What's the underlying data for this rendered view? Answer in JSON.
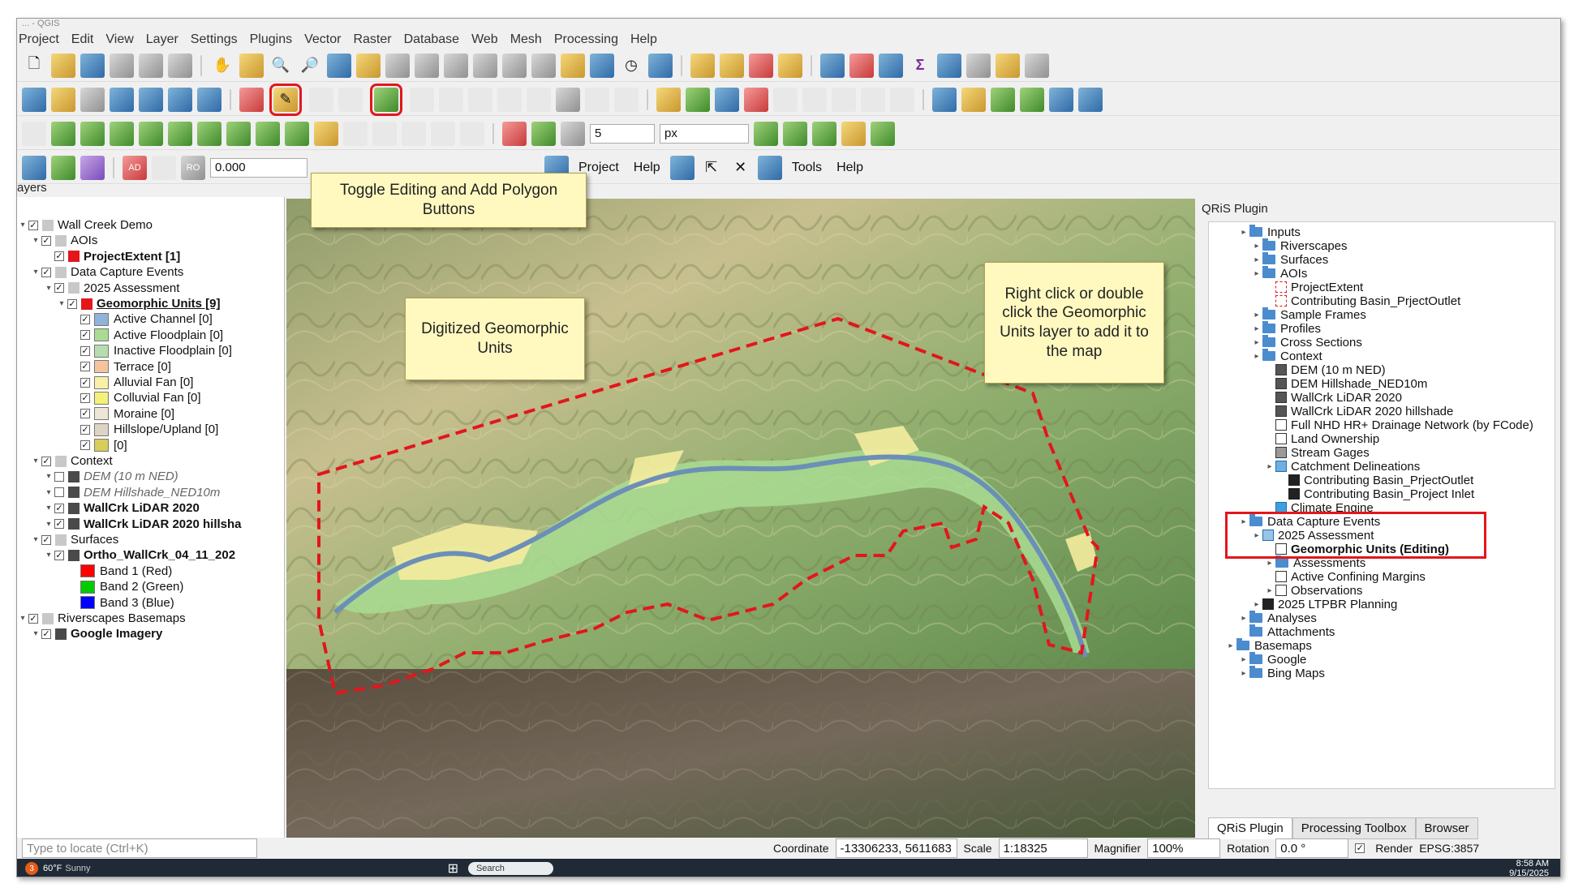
{
  "window": {
    "title": "... - QGIS"
  },
  "menu": [
    "Project",
    "Edit",
    "View",
    "Layer",
    "Settings",
    "Plugins",
    "Vector",
    "Raster",
    "Database",
    "Web",
    "Mesh",
    "Processing",
    "Help"
  ],
  "toolbar3": {
    "snap_value": "5",
    "snap_unit": "px"
  },
  "toolbar4": {
    "opacity_value": "0.000",
    "project_label": "Project",
    "help_label": "Help",
    "tools_label": "Tools",
    "help2_label": "Help",
    "ad_label": "AD",
    "ro_label": "RO"
  },
  "layers_panel": {
    "title": "ayers",
    "items": [
      {
        "label": "Wall Creek Demo"
      },
      {
        "label": "AOIs"
      },
      {
        "label": "ProjectExtent [1]"
      },
      {
        "label": "Data Capture Events"
      },
      {
        "label": "2025 Assessment"
      },
      {
        "label": "Geomorphic Units [9]"
      },
      {
        "label": "Active Channel [0]",
        "color": "#8fb3d9"
      },
      {
        "label": "Active Floodplain [0]",
        "color": "#a9dc92"
      },
      {
        "label": "Inactive Floodplain [0]",
        "color": "#b7dcb0"
      },
      {
        "label": "Terrace [0]",
        "color": "#f5c49e"
      },
      {
        "label": "Alluvial Fan [0]",
        "color": "#f6f0a8"
      },
      {
        "label": "Colluvial Fan [0]",
        "color": "#f4f07a"
      },
      {
        "label": "Moraine [0]",
        "color": "#ece6d6"
      },
      {
        "label": "Hillslope/Upland [0]",
        "color": "#ddd4c4"
      },
      {
        "label": "[0]",
        "color": "#d8cc5a"
      },
      {
        "label": "Context"
      },
      {
        "label": "DEM (10 m NED)"
      },
      {
        "label": "DEM Hillshade_NED10m"
      },
      {
        "label": "WallCrk LiDAR 2020"
      },
      {
        "label": "WallCrk LiDAR 2020 hillsha"
      },
      {
        "label": "Surfaces"
      },
      {
        "label": "Ortho_WallCrk_04_11_202"
      },
      {
        "label": "Band 1 (Red)",
        "color": "#ff0000"
      },
      {
        "label": "Band 2 (Green)",
        "color": "#00cc00"
      },
      {
        "label": "Band 3 (Blue)",
        "color": "#0000ff"
      },
      {
        "label": "Riverscapes Basemaps"
      },
      {
        "label": "Google Imagery"
      }
    ]
  },
  "qris": {
    "title": "QRiS Plugin",
    "items": [
      {
        "label": "Inputs"
      },
      {
        "label": "Riverscapes"
      },
      {
        "label": "Surfaces"
      },
      {
        "label": "AOIs"
      },
      {
        "label": "ProjectExtent"
      },
      {
        "label": "Contributing Basin_PrjectOutlet"
      },
      {
        "label": "Sample Frames"
      },
      {
        "label": "Profiles"
      },
      {
        "label": "Cross Sections"
      },
      {
        "label": "Context"
      },
      {
        "label": "DEM (10 m NED)"
      },
      {
        "label": "DEM Hillshade_NED10m"
      },
      {
        "label": "WallCrk LiDAR 2020"
      },
      {
        "label": "WallCrk LiDAR 2020 hillshade"
      },
      {
        "label": "Full NHD HR+ Drainage Network (by FCode)"
      },
      {
        "label": "Land Ownership"
      },
      {
        "label": "Stream Gages"
      },
      {
        "label": "Catchment Delineations"
      },
      {
        "label": "Contributing Basin_PrjectOutlet"
      },
      {
        "label": "Contributing Basin_Project Inlet"
      },
      {
        "label": "Climate Engine"
      },
      {
        "label": "Data Capture Events"
      },
      {
        "label": "2025 Assessment"
      },
      {
        "label": "Geomorphic Units (Editing)"
      },
      {
        "label": "Assessments"
      },
      {
        "label": "Active Confining Margins"
      },
      {
        "label": "Observations"
      },
      {
        "label": "2025 LTPBR Planning"
      },
      {
        "label": "Analyses"
      },
      {
        "label": "Attachments"
      },
      {
        "label": "Basemaps"
      },
      {
        "label": "Google"
      },
      {
        "label": "Bing Maps"
      }
    ],
    "tabs": [
      "QRiS Plugin",
      "Processing Toolbox",
      "Browser"
    ]
  },
  "callouts": {
    "toggle": "Toggle Editing and Add Polygon Buttons",
    "digitized": "Digitized Geomorphic Units",
    "rightclick": "Right click or double click the Geomorphic Units layer to add it to the map"
  },
  "status": {
    "locate_placeholder": "Type to locate (Ctrl+K)",
    "coordinate_label": "Coordinate",
    "coordinate_value": "-13306233, 5611683",
    "scale_label": "Scale",
    "scale_value": "1:18325",
    "magnifier_label": "Magnifier",
    "magnifier_value": "100%",
    "rotation_label": "Rotation",
    "rotation_value": "0.0 °",
    "render_label": "Render",
    "crs": "EPSG:3857"
  },
  "taskbar": {
    "temp": "60°F",
    "weather": "Sunny",
    "search": "Search",
    "time": "8:58 AM",
    "date": "9/15/2025",
    "badge": "3"
  }
}
